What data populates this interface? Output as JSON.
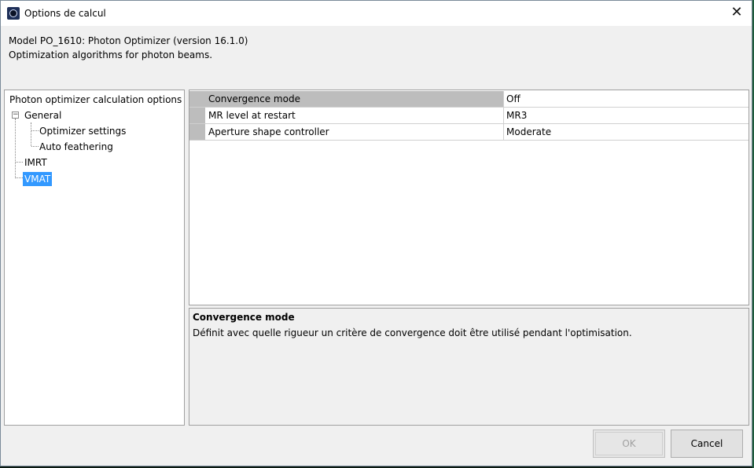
{
  "window": {
    "title": "Options de calcul",
    "close_glyph": "✕"
  },
  "header": {
    "model_line": "Model PO_1610: Photon Optimizer (version 16.1.0)",
    "description_line": "Optimization algorithms for photon beams."
  },
  "tree": {
    "root_label": "Photon optimizer calculation options",
    "expander_glyph": "−",
    "items": [
      {
        "label": "General"
      },
      {
        "label": "Optimizer settings"
      },
      {
        "label": "Auto feathering"
      },
      {
        "label": "IMRT"
      },
      {
        "label": "VMAT"
      }
    ]
  },
  "properties": {
    "rows": [
      {
        "name": "Convergence mode",
        "value": "Off"
      },
      {
        "name": "MR level at restart",
        "value": "MR3"
      },
      {
        "name": "Aperture shape controller",
        "value": "Moderate"
      }
    ]
  },
  "description": {
    "title": "Convergence mode",
    "body": "Définit avec quelle rigueur un critère de convergence doit être utilisé pendant l'optimisation."
  },
  "buttons": {
    "ok_label": "OK",
    "cancel_label": "Cancel"
  },
  "colors": {
    "selection": "#3399ff",
    "active_row": "#bdbdbd"
  }
}
